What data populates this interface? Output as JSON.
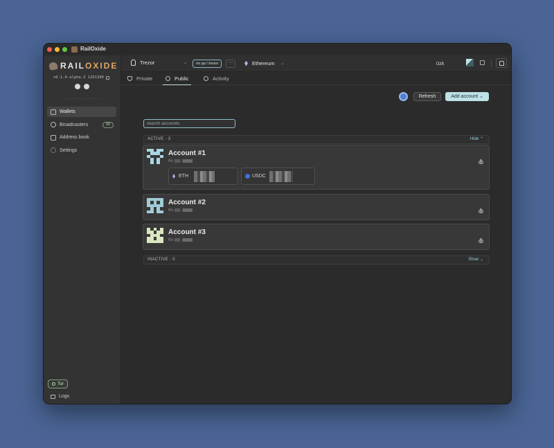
{
  "window": {
    "title": "RailOxide"
  },
  "sidebar": {
    "logo": {
      "part1": "RAIL",
      "part2": "OXIDE"
    },
    "version": "v0.1.0-alpha.3 1261390",
    "nav": [
      {
        "label": "Wallets",
        "icon": "wallet-icon",
        "active": true
      },
      {
        "label": "Broadcasters",
        "icon": "broadcast-icon",
        "badge": "30"
      },
      {
        "label": "Address book",
        "icon": "address-book-icon"
      },
      {
        "label": "Settings",
        "icon": "gear-icon"
      }
    ],
    "tor": "Tor",
    "logs": "Logs"
  },
  "topbar": {
    "device": "Trezor",
    "pp_chip": "no pp / trezor",
    "more": "···",
    "network": "Ethereum",
    "balance": "0zk"
  },
  "tabs": [
    {
      "label": "Private",
      "icon": "shield-icon"
    },
    {
      "label": "Public",
      "icon": "globe-icon",
      "active": true
    },
    {
      "label": "Activity",
      "icon": "history-icon"
    }
  ],
  "actions": {
    "refresh": "Refresh",
    "add_account": "Add account"
  },
  "search": {
    "placeholder": "search accounts"
  },
  "active_section": {
    "label": "ACTIVE · 3",
    "toggle": "Hide"
  },
  "inactive_section": {
    "label": "INACTIVE · 0",
    "toggle": "Show"
  },
  "accounts": [
    {
      "name": "Account #1",
      "address_prefix": "0x",
      "tokens": [
        {
          "symbol": "ETH"
        },
        {
          "symbol": "USDC"
        }
      ]
    },
    {
      "name": "Account #2",
      "address_prefix": "0x"
    },
    {
      "name": "Account #3",
      "address_prefix": "0x"
    }
  ],
  "colors": {
    "accent": "#bde2e8",
    "background": "#2b2b2b",
    "sidebar": "#333333",
    "tor_green": "#7fa080",
    "logo_accent": "#e2a765"
  }
}
